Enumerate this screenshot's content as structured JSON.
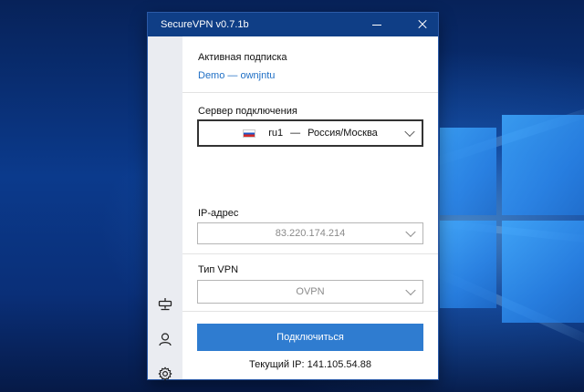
{
  "window": {
    "title": "SecureVPN v0.7.1b"
  },
  "subscription": {
    "label": "Активная подписка",
    "value": "Demo — ownjntu"
  },
  "server": {
    "label": "Сервер подключения",
    "id": "ru1",
    "separator": "—",
    "location": "Россия/Москва",
    "flag": "russia-flag"
  },
  "ip": {
    "label": "IP-адрес",
    "value": "83.220.174.214"
  },
  "vpn_type": {
    "label": "Тип VPN",
    "value": "OVPN"
  },
  "connect": {
    "label": "Подключиться"
  },
  "current_ip": {
    "text": "Текущий IP: 141.105.54.88"
  },
  "colors": {
    "titlebar": "#0f3e86",
    "accent_button": "#2f7cd0",
    "link": "#1f6fc5",
    "sidebar": "#eaecf1"
  },
  "sidebar_icons": [
    "network-icon",
    "user-icon",
    "gear-icon"
  ]
}
